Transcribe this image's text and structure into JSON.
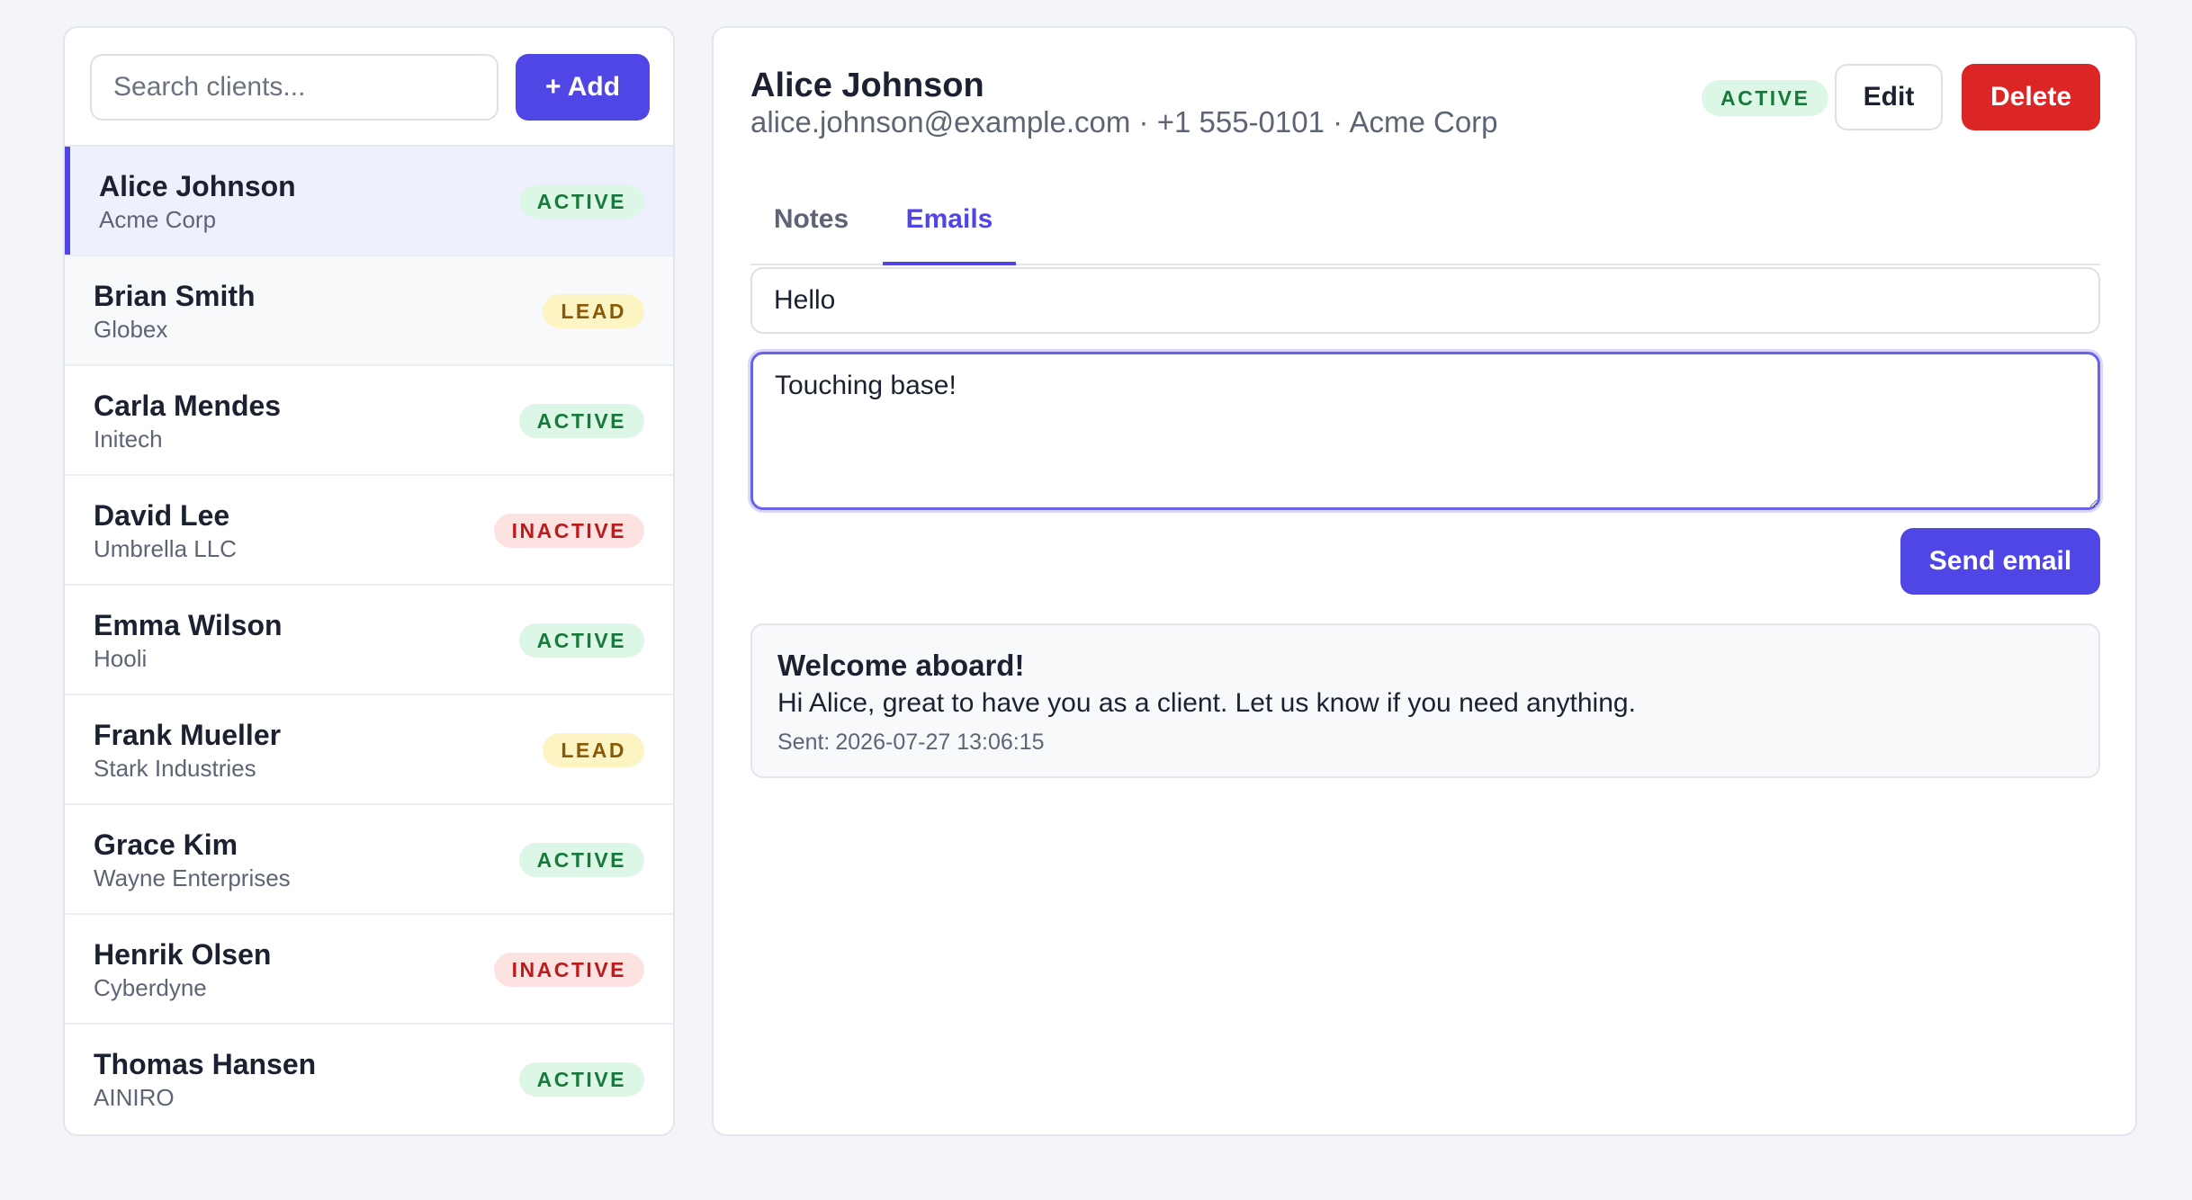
{
  "sidebar": {
    "search_placeholder": "Search clients...",
    "add_label": "+ Add",
    "clients": [
      {
        "name": "Alice Johnson",
        "company": "Acme Corp",
        "status": "ACTIVE"
      },
      {
        "name": "Brian Smith",
        "company": "Globex",
        "status": "LEAD"
      },
      {
        "name": "Carla Mendes",
        "company": "Initech",
        "status": "ACTIVE"
      },
      {
        "name": "David Lee",
        "company": "Umbrella LLC",
        "status": "INACTIVE"
      },
      {
        "name": "Emma Wilson",
        "company": "Hooli",
        "status": "ACTIVE"
      },
      {
        "name": "Frank Mueller",
        "company": "Stark Industries",
        "status": "LEAD"
      },
      {
        "name": "Grace Kim",
        "company": "Wayne Enterprises",
        "status": "ACTIVE"
      },
      {
        "name": "Henrik Olsen",
        "company": "Cyberdyne",
        "status": "INACTIVE"
      },
      {
        "name": "Thomas Hansen",
        "company": "AINIRO",
        "status": "ACTIVE"
      }
    ]
  },
  "detail": {
    "name": "Alice Johnson",
    "meta": "alice.johnson@example.com · +1 555-0101 · Acme Corp",
    "status": "ACTIVE",
    "edit_label": "Edit",
    "delete_label": "Delete",
    "tabs": [
      {
        "label": "Notes"
      },
      {
        "label": "Emails"
      }
    ],
    "active_tab": "Emails",
    "compose": {
      "subject_value": "Hello",
      "body_value": "Touching base!",
      "send_label": "Send email"
    },
    "emails": [
      {
        "subject": "Welcome aboard!",
        "body": "Hi Alice, great to have you as a client. Let us know if you need anything.",
        "sent_label": "Sent:",
        "sent_at": "2026-07-27 13:06:15"
      }
    ]
  },
  "colors": {
    "accent": "#4f46e5",
    "danger": "#dc2626",
    "active_bg": "#dcf7e6",
    "active_fg": "#177a3a",
    "lead_bg": "#fdf4c3",
    "lead_fg": "#8a5a06",
    "inactive_bg": "#fde2e2",
    "inactive_fg": "#b91c1c"
  }
}
